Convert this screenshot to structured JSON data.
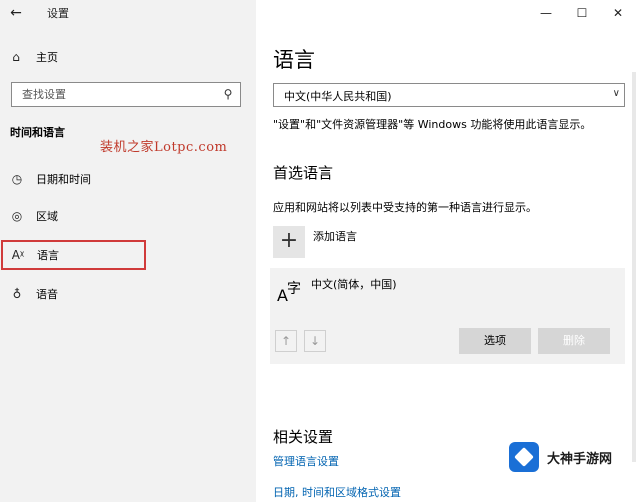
{
  "window": {
    "title": "设置",
    "controls": [
      "—",
      "☐",
      "✕"
    ]
  },
  "sidebar": {
    "back_icon": "←",
    "home": {
      "icon": "⌂",
      "label": "主页"
    },
    "search_placeholder": "查找设置",
    "search_icon": "⚲",
    "section_title": "时间和语言",
    "items": [
      {
        "icon": "◷",
        "label": "日期和时间"
      },
      {
        "icon": "◎",
        "label": "区域"
      },
      {
        "icon": "Aᵡ",
        "label": "语言"
      },
      {
        "icon": "♁",
        "label": "语音"
      }
    ]
  },
  "watermark": "装机之家Lotpc.com",
  "main": {
    "page_title": "语言",
    "display_language": "中文(中华人民共和国)",
    "display_language_desc": "\"设置\"和\"文件资源管理器\"等 Windows 功能将使用此语言显示。",
    "preferred_heading": "首选语言",
    "preferred_desc": "应用和网站将以列表中受支持的第一种语言进行显示。",
    "add_language_label": "添加语言",
    "language_item": {
      "glyph_a": "A",
      "glyph_zi": "字",
      "name": "中文(简体，中国)",
      "options_label": "选项",
      "remove_label": "删除"
    },
    "related_heading": "相关设置",
    "related_links": [
      "管理语言设置",
      "日期, 时间和区域格式设置"
    ]
  },
  "brand_badge": "大神手游网",
  "colors": {
    "sidebar_bg": "#f2f2f2",
    "highlight_border": "#d03a3a",
    "link": "#0063b1",
    "watermark": "#c0392b"
  }
}
